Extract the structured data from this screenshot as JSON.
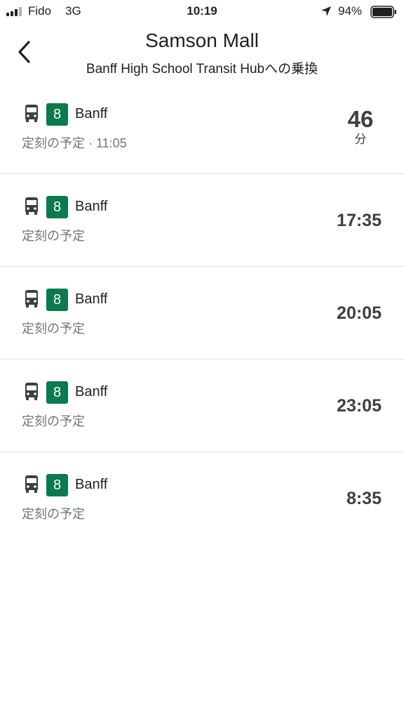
{
  "status_bar": {
    "carrier": "Fido",
    "network": "3G",
    "time": "10:19",
    "battery": "94%"
  },
  "header": {
    "title": "Samson Mall",
    "subtitle": "Banff High School Transit Hubへの乗換"
  },
  "colors": {
    "route_badge": "#0b7a4e",
    "secondary_text": "#70757a",
    "divider": "#e0e0e0"
  },
  "departures": [
    {
      "route": "8",
      "destination": "Banff",
      "schedule": "定刻の予定 · 11:05",
      "minutes": "46",
      "minutes_unit": "分"
    },
    {
      "route": "8",
      "destination": "Banff",
      "schedule": "定刻の予定",
      "time": "17:35"
    },
    {
      "route": "8",
      "destination": "Banff",
      "schedule": "定刻の予定",
      "time": "20:05"
    },
    {
      "route": "8",
      "destination": "Banff",
      "schedule": "定刻の予定",
      "time": "23:05"
    },
    {
      "route": "8",
      "destination": "Banff",
      "schedule": "定刻の予定",
      "time": "8:35"
    }
  ]
}
